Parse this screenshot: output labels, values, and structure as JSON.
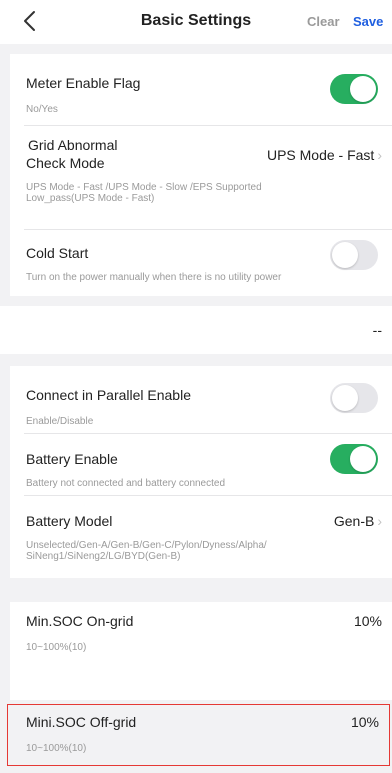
{
  "header": {
    "title": "Basic Settings",
    "clear_label": "Clear",
    "save_label": "Save",
    "colors": {
      "save": "#1f5fe0",
      "clear": "#9a9a9a"
    }
  },
  "section1": {
    "meter": {
      "label": "Meter Enable Flag",
      "sub": "No/Yes",
      "toggle": "on"
    },
    "grid": {
      "label_line1": "Grid Abnormal",
      "label_line2": "Check Mode",
      "value": "UPS Mode - Fast",
      "sub_line1": "UPS Mode - Fast /UPS Mode - Slow /EPS Supported",
      "sub_line2": "Low_pass(UPS Mode - Fast)"
    },
    "cold_start": {
      "label": "Cold Start",
      "sub": "Turn on the power manually when there is no utility power",
      "toggle": "off"
    }
  },
  "section2": {
    "value": "--"
  },
  "section3": {
    "parallel": {
      "label": "Connect in Parallel Enable",
      "sub": "Enable/Disable",
      "toggle": "off"
    },
    "battery_enable": {
      "label": "Battery Enable",
      "sub": "Battery not connected and battery connected",
      "toggle": "on"
    },
    "battery_model": {
      "label": "Battery Model",
      "value": "Gen-B",
      "sub_line1": "Unselected/Gen-A/Gen-B/Gen-C/Pylon/Dyness/Alpha/",
      "sub_line2": "SiNeng1/SiNeng2/LG/BYD(Gen-B)"
    }
  },
  "section4": {
    "min_soc_on": {
      "label": "Min.SOC On-grid",
      "value": "10%",
      "sub": "10~100%(10)"
    },
    "min_soc_off": {
      "label": "Mini.SOC Off-grid",
      "value": "10%",
      "sub": "10~100%(10)"
    }
  },
  "theme": {
    "toggle_on": "#27ae60",
    "toggle_off": "#e6e6ea",
    "highlight_border": "#e53935"
  }
}
